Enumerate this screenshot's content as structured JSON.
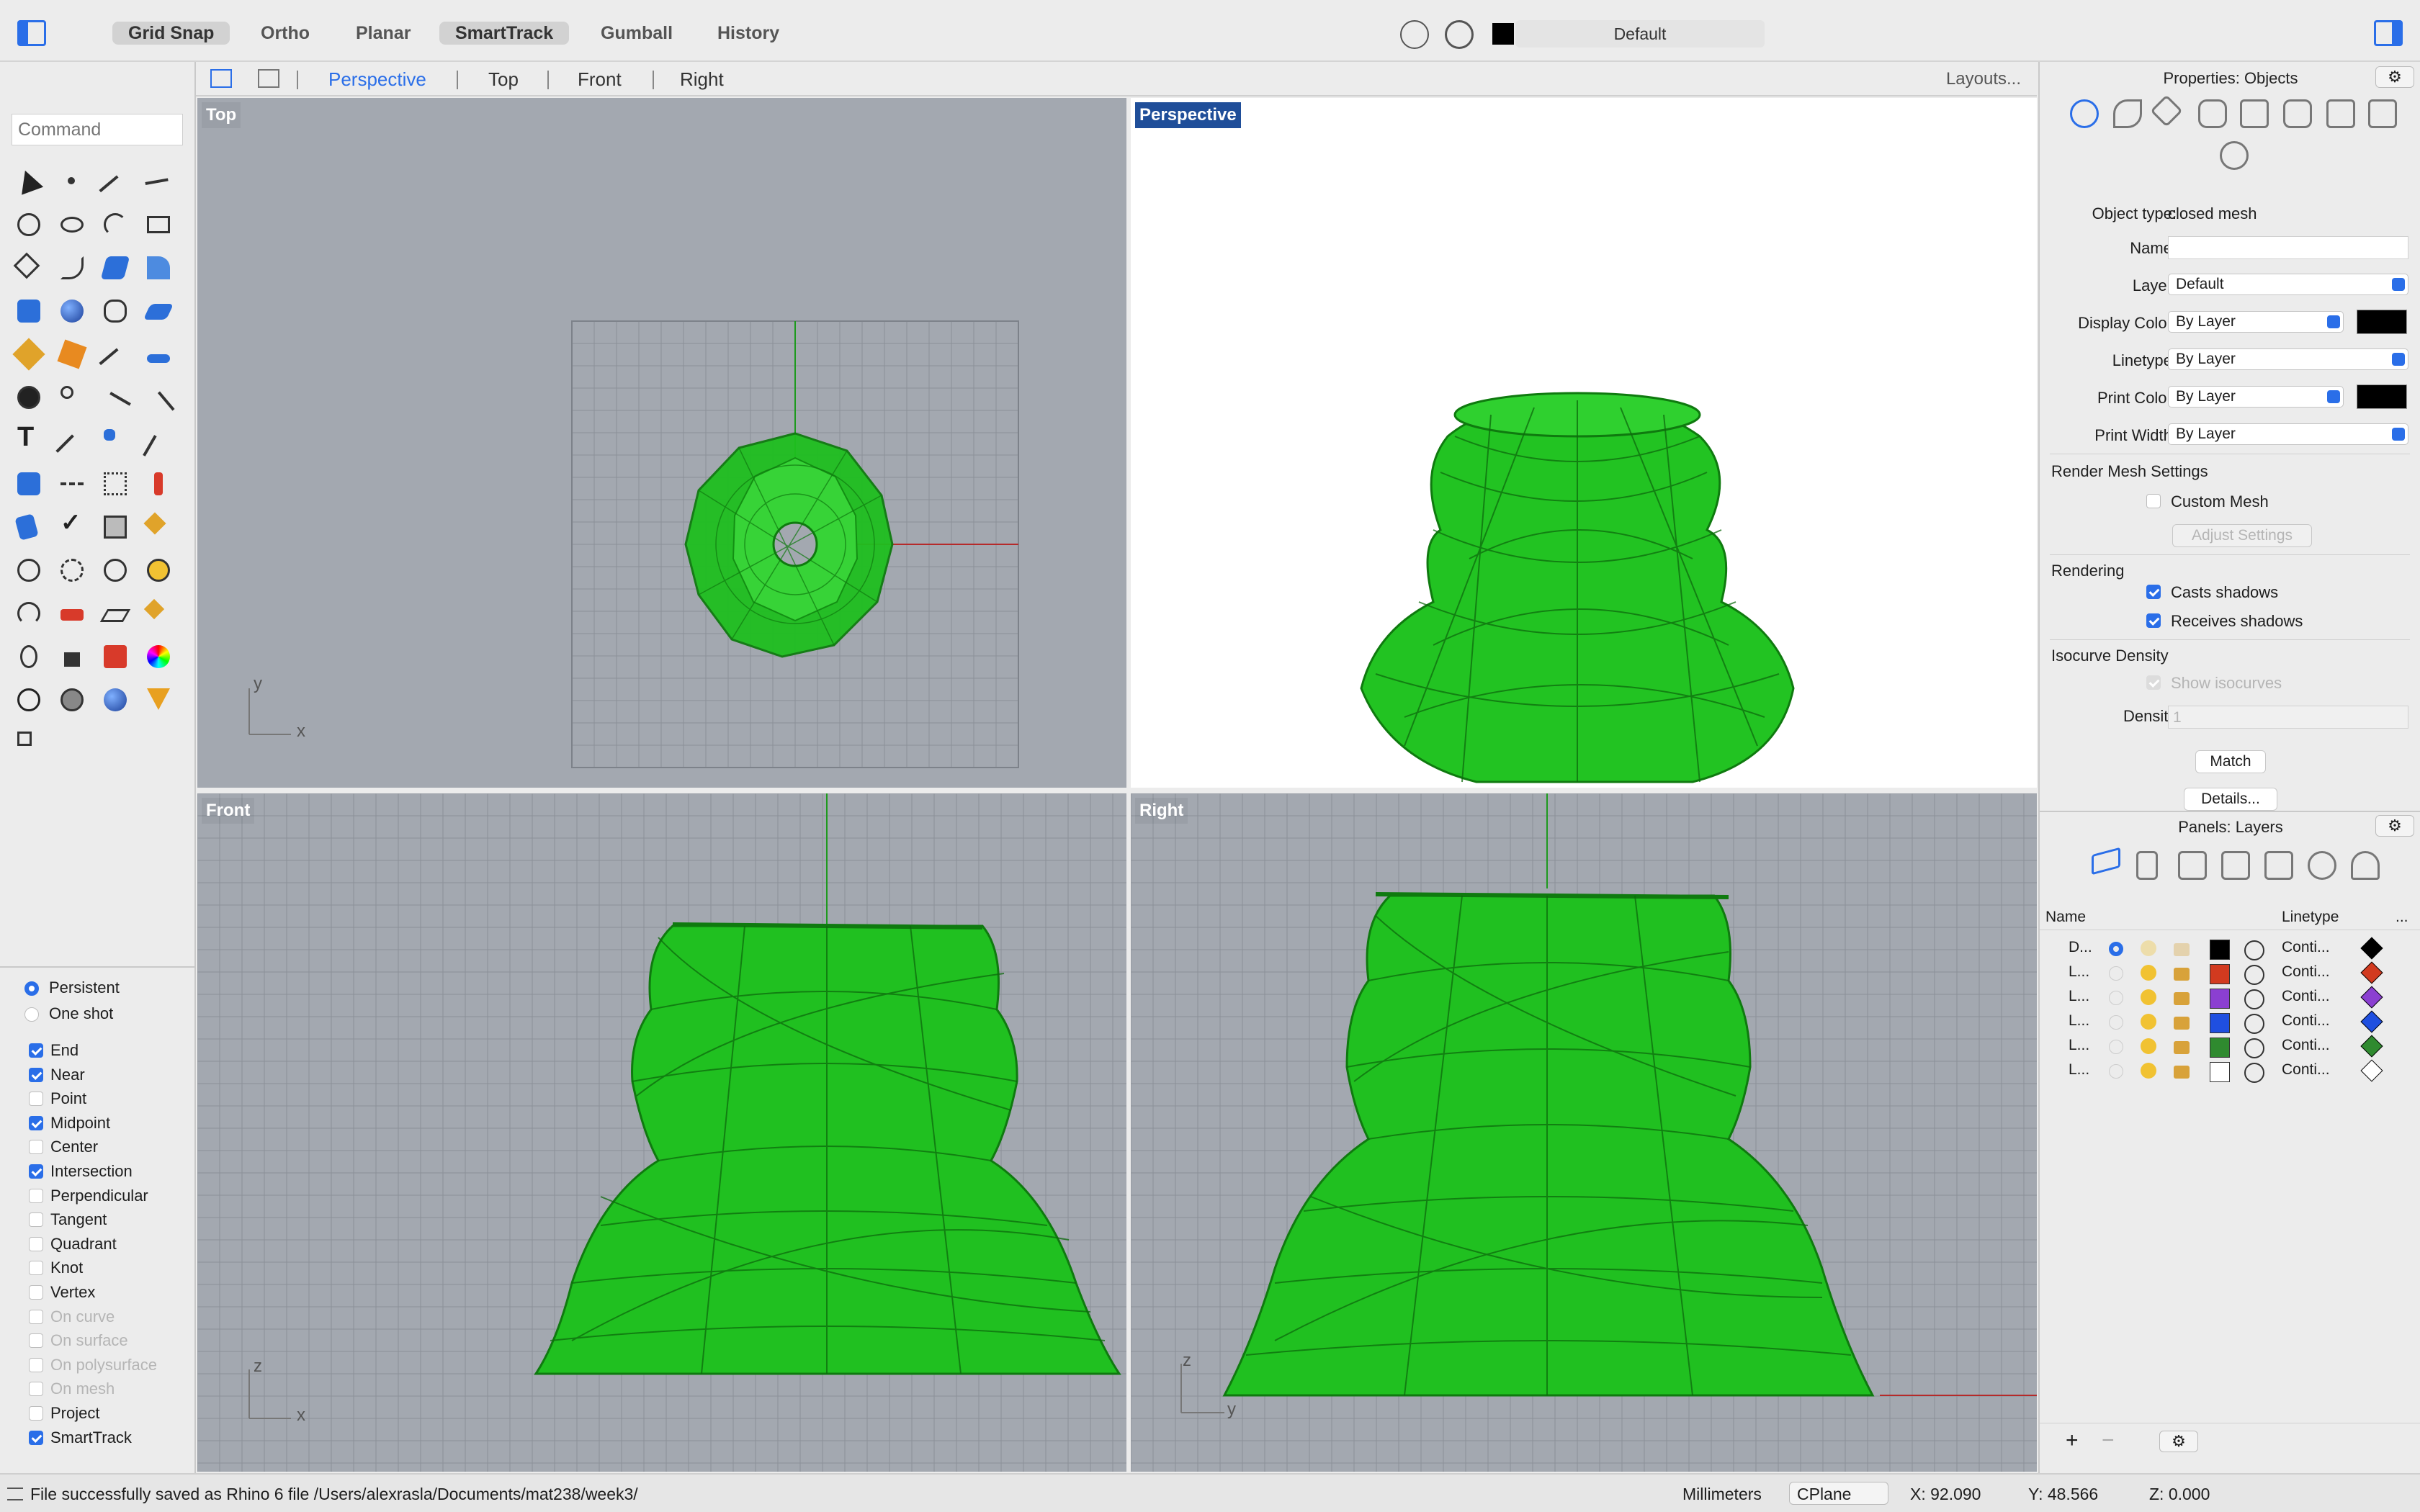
{
  "toolbar": {
    "modes": [
      {
        "label": "Grid Snap",
        "on": true
      },
      {
        "label": "Ortho",
        "on": false
      },
      {
        "label": "Planar",
        "on": false
      },
      {
        "label": "SmartTrack",
        "on": true
      },
      {
        "label": "Gumball",
        "on": false
      },
      {
        "label": "History",
        "on": false
      }
    ],
    "current_layer": "Default"
  },
  "command": {
    "placeholder": "Command"
  },
  "snaps": {
    "mode": [
      {
        "label": "Persistent",
        "on": true
      },
      {
        "label": "One shot",
        "on": false
      }
    ],
    "items": [
      {
        "label": "End",
        "on": true,
        "enabled": true
      },
      {
        "label": "Near",
        "on": true,
        "enabled": true
      },
      {
        "label": "Point",
        "on": false,
        "enabled": true
      },
      {
        "label": "Midpoint",
        "on": true,
        "enabled": true
      },
      {
        "label": "Center",
        "on": false,
        "enabled": true
      },
      {
        "label": "Intersection",
        "on": true,
        "enabled": true
      },
      {
        "label": "Perpendicular",
        "on": false,
        "enabled": true
      },
      {
        "label": "Tangent",
        "on": false,
        "enabled": true
      },
      {
        "label": "Quadrant",
        "on": false,
        "enabled": true
      },
      {
        "label": "Knot",
        "on": false,
        "enabled": true
      },
      {
        "label": "Vertex",
        "on": false,
        "enabled": true
      },
      {
        "label": "On curve",
        "on": false,
        "enabled": false
      },
      {
        "label": "On surface",
        "on": false,
        "enabled": false
      },
      {
        "label": "On polysurface",
        "on": false,
        "enabled": false
      },
      {
        "label": "On mesh",
        "on": false,
        "enabled": false
      },
      {
        "label": "Project",
        "on": false,
        "enabled": true
      },
      {
        "label": "SmartTrack",
        "on": true,
        "enabled": true
      }
    ]
  },
  "viewport_tabs": {
    "tabs": [
      "Perspective",
      "Top",
      "Front",
      "Right"
    ],
    "active": "Perspective",
    "layouts": "Layouts..."
  },
  "viewports": {
    "top": {
      "label": "Top",
      "axis_a": "y",
      "axis_b": "x"
    },
    "perspective": {
      "label": "Perspective"
    },
    "front": {
      "label": "Front",
      "axis_a": "z",
      "axis_b": "x"
    },
    "right": {
      "label": "Right",
      "axis_a": "z",
      "axis_b": "y"
    }
  },
  "properties": {
    "title": "Properties: Objects",
    "object_type_label": "Object type:",
    "object_type": "closed mesh",
    "name_label": "Name:",
    "name_value": "",
    "layer_label": "Layer:",
    "layer": "Default",
    "display_color_label": "Display Color:",
    "display_color": "By Layer",
    "linetype_label": "Linetype:",
    "linetype": "By Layer",
    "print_color_label": "Print Color:",
    "print_color": "By Layer",
    "print_width_label": "Print Width:",
    "print_width": "By Layer",
    "render_mesh_section": "Render Mesh Settings",
    "custom_mesh": "Custom Mesh",
    "adjust_settings": "Adjust Settings",
    "rendering_section": "Rendering",
    "casts_shadows": "Casts shadows",
    "receives_shadows": "Receives shadows",
    "isocurve_section": "Isocurve Density",
    "show_isocurves": "Show isocurves",
    "density_label": "Density:",
    "density_value": "1",
    "match": "Match",
    "details": "Details..."
  },
  "layers": {
    "title": "Panels: Layers",
    "col_name": "Name",
    "col_linetype": "Linetype",
    "col_more": "...",
    "rows": [
      {
        "name": "D...",
        "current": true,
        "color": "#000000",
        "linetype": "Conti..."
      },
      {
        "name": "L...",
        "current": false,
        "color": "#d23a1f",
        "linetype": "Conti..."
      },
      {
        "name": "L...",
        "current": false,
        "color": "#8b3fd1",
        "linetype": "Conti..."
      },
      {
        "name": "L...",
        "current": false,
        "color": "#1f4fe0",
        "linetype": "Conti..."
      },
      {
        "name": "L...",
        "current": false,
        "color": "#2f8a2f",
        "linetype": "Conti..."
      },
      {
        "name": "L...",
        "current": false,
        "color": "#ffffff",
        "linetype": "Conti..."
      }
    ]
  },
  "status": {
    "message": "File successfully saved as Rhino 6 file /Users/alexrasla/Documents/mat238/week3/",
    "units": "Millimeters",
    "cplane": "CPlane",
    "x": "X: 92.090",
    "y": "Y: 48.566",
    "z": "Z: 0.000"
  },
  "colors": {
    "mesh": "#1fbf1f",
    "accent": "#2a6ee8"
  }
}
